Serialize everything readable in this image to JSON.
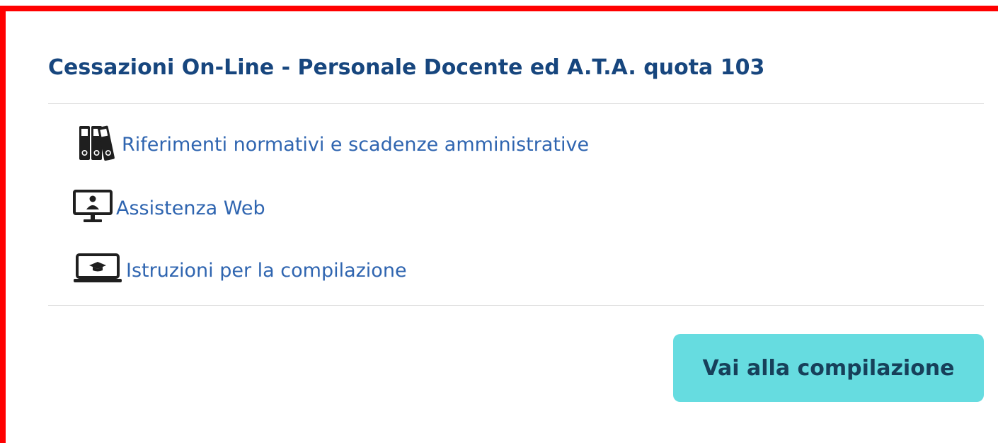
{
  "card": {
    "title": "Cessazioni On-Line - Personale Docente ed A.T.A. quota 103",
    "links": [
      {
        "label": "Riferimenti normativi e scadenze amministrative",
        "icon": "binders-icon"
      },
      {
        "label": "Assistenza Web",
        "icon": "monitor-user-icon"
      },
      {
        "label": "Istruzioni per la compilazione",
        "icon": "laptop-graduation-icon"
      }
    ],
    "cta_label": "Vai alla compilazione"
  },
  "colors": {
    "frame_border": "#ff0000",
    "title": "#17467e",
    "link": "#2f65b0",
    "cta_background": "#66dce0",
    "cta_text": "#17405a",
    "divider": "#dcdcdc"
  }
}
